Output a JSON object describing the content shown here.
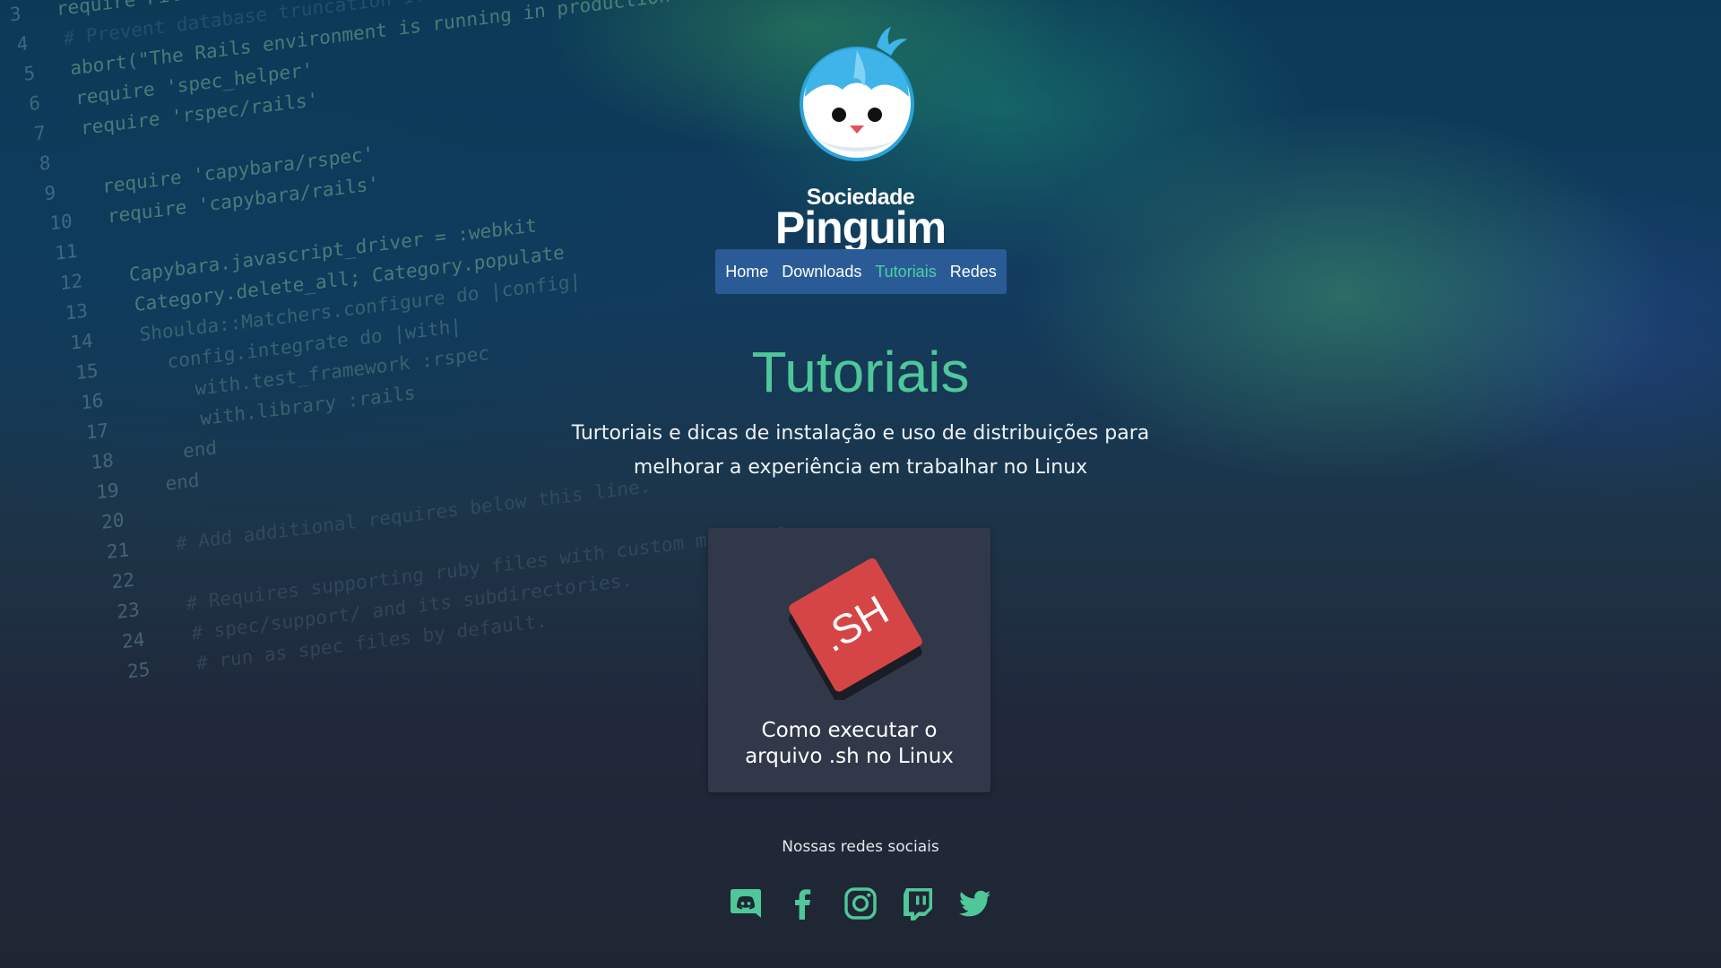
{
  "background": {
    "code_lines": [
      {
        "n": "3",
        "code": "require File.expand_path('../../config/environment', __FILE__)"
      },
      {
        "n": "4",
        "code": "# Prevent database truncation if the environment is production"
      },
      {
        "n": "5",
        "code": "abort(\"The Rails environment is running in production mode!\") if Rails.env.production?"
      },
      {
        "n": "6",
        "code": "require 'spec_helper'"
      },
      {
        "n": "7",
        "code": "require 'rspec/rails'"
      },
      {
        "n": "8",
        "code": ""
      },
      {
        "n": "9",
        "code": " require 'capybara/rspec'"
      },
      {
        "n": "10",
        "code": " require 'capybara/rails'"
      },
      {
        "n": "11",
        "code": ""
      },
      {
        "n": "12",
        "code": "  Capybara.javascript_driver = :webkit"
      },
      {
        "n": "13",
        "code": "  Category.delete_all; Category.populate"
      },
      {
        "n": "14",
        "code": "  Shoulda::Matchers.configure do |config|"
      },
      {
        "n": "15",
        "code": "    config.integrate do |with|"
      },
      {
        "n": "16",
        "code": "      with.test_framework :rspec"
      },
      {
        "n": "17",
        "code": "      with.library :rails"
      },
      {
        "n": "18",
        "code": "    end"
      },
      {
        "n": "19",
        "code": "  end"
      },
      {
        "n": "20",
        "code": ""
      },
      {
        "n": "21",
        "code": "  # Add additional requires below this line."
      },
      {
        "n": "22",
        "code": ""
      },
      {
        "n": "23",
        "code": "  # Requires supporting ruby files with custom matchers"
      },
      {
        "n": "24",
        "code": "  # spec/support/ and its subdirectories."
      },
      {
        "n": "25",
        "code": "  # run as spec files by default."
      }
    ]
  },
  "logo": {
    "line1": "Sociedade",
    "line2": "Pinguim",
    "icon": "penguin-mascot-icon"
  },
  "nav": {
    "items": [
      {
        "label": "Home",
        "active": false
      },
      {
        "label": "Downloads",
        "active": false
      },
      {
        "label": "Tutoriais",
        "active": true
      },
      {
        "label": "Redes",
        "active": false
      }
    ]
  },
  "page": {
    "title": "Tutoriais",
    "subtitle_line1": "Turtoriais e dicas de instalação e uso de distribuições para",
    "subtitle_line2": "melhorar a experiência em trabalhar no Linux"
  },
  "cards": [
    {
      "icon_text": ".SH",
      "icon": "sh-file-icon",
      "title_line1": "Como executar o",
      "title_line2": "arquivo .sh no Linux"
    }
  ],
  "footer": {
    "social_label": "Nossas redes sociais",
    "social": [
      "discord-icon",
      "facebook-icon",
      "instagram-icon",
      "twitch-icon",
      "twitter-icon"
    ]
  },
  "colors": {
    "accent": "#4fc79a",
    "nav_bg": "#2a5b97",
    "card_bg": "#313849",
    "sh_red": "#d64545",
    "page_bg": "#1f2633",
    "mascot_blue": "#3fb4e8"
  }
}
